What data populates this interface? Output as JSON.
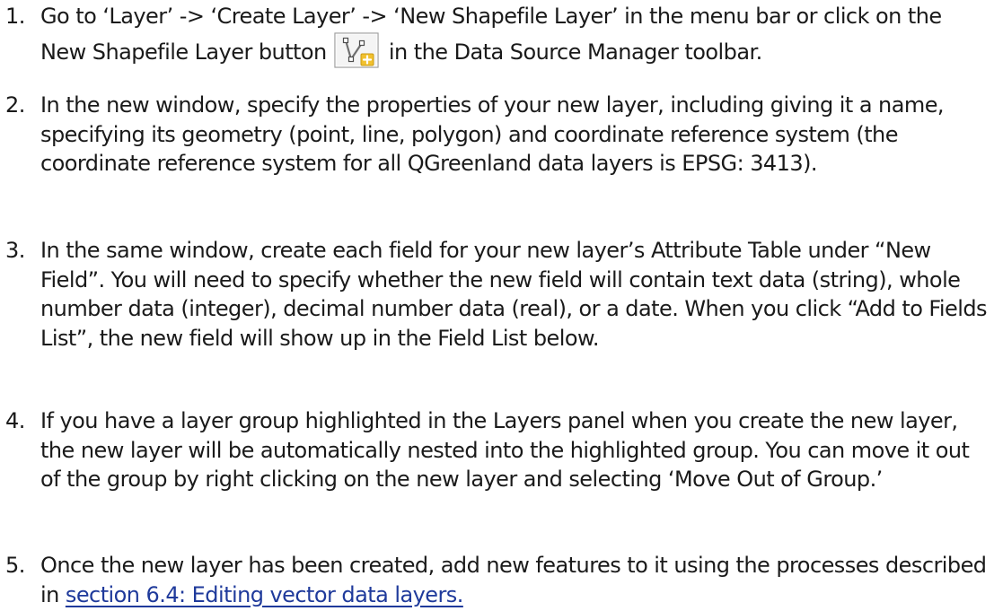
{
  "steps": [
    {
      "number": "1.",
      "text_before_icon": "Go to ‘Layer’ -> ‘Create Layer’ -> ‘New Shapefile Layer’ in the menu bar or click on the New Shapefile Layer button",
      "icon": "new-shapefile-layer-icon",
      "text_after_icon": "in the Data Source Manager toolbar."
    },
    {
      "number": "2.",
      "text": "In the new window, specify the properties of your new layer, including giving it a name, specifying its geometry (point, line, polygon) and coordinate reference system (the coordinate reference system for all QGreenland data layers is EPSG: 3413)."
    },
    {
      "number": "3.",
      "text": "In the same window, create each field for your new layer’s Attribute Table under “New Field”. You will need to specify whether the new field will contain text data (string), whole number data (integer), decimal number data (real), or a date. When you click “Add to Fields List”, the new field will show up in the Field List below."
    },
    {
      "number": "4.",
      "text": "If you have a layer group highlighted in the Layers panel when you create the new layer, the new layer will be automatically nested into the highlighted group. You can move it out of the group by right clicking on the new layer and selecting ‘Move Out of Group.’"
    },
    {
      "number": "5.",
      "text_before_link": "Once the new layer has been created, add new features to it using the processes described in",
      "link_text": "section 6.4: Editing vector data layers."
    }
  ],
  "colors": {
    "text": "#1a1a1a",
    "link": "#1f3a9b"
  }
}
